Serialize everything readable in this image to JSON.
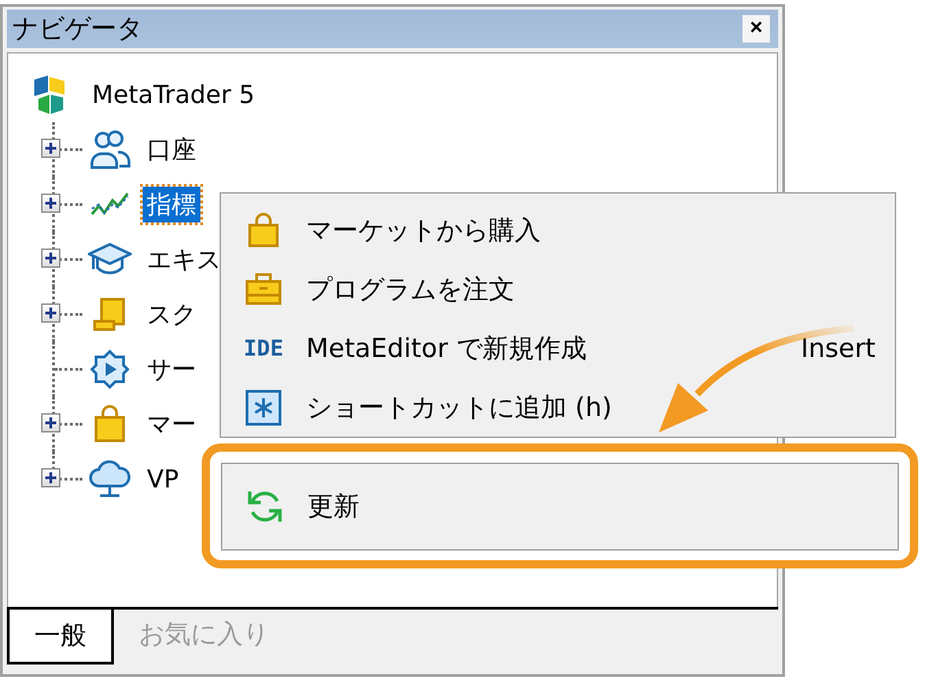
{
  "window": {
    "title": "ナビゲータ",
    "close": "×"
  },
  "tree": {
    "root": {
      "label": "MetaTrader 5"
    },
    "children": [
      {
        "label": "口座",
        "kind": "accounts",
        "expandable": true,
        "selected": false
      },
      {
        "label": "指標",
        "kind": "indicators",
        "expandable": true,
        "selected": true
      },
      {
        "label": "エキス",
        "kind": "experts",
        "expandable": true,
        "selected": false
      },
      {
        "label": "スク",
        "kind": "scripts",
        "expandable": true,
        "selected": false
      },
      {
        "label": "サー",
        "kind": "services",
        "expandable": false,
        "selected": false
      },
      {
        "label": "マー",
        "kind": "market",
        "expandable": true,
        "selected": false
      },
      {
        "label": "VP",
        "kind": "vps",
        "expandable": true,
        "selected": false
      }
    ]
  },
  "context_menu": {
    "items": [
      {
        "label": "マーケットから購入",
        "kind": "bag"
      },
      {
        "label": "プログラムを注文",
        "kind": "briefcase"
      },
      {
        "label": "MetaEditor で新規作成",
        "kind": "ide",
        "icon_text": "IDE",
        "shortcut": "Insert"
      },
      {
        "label": "ショートカットに追加 (h)",
        "kind": "shortcut"
      }
    ],
    "highlighted_item": {
      "label": "更新",
      "kind": "refresh"
    }
  },
  "tabs": [
    {
      "label": "一般",
      "selected": true
    },
    {
      "label": "お気に入り",
      "selected": false
    }
  ]
}
